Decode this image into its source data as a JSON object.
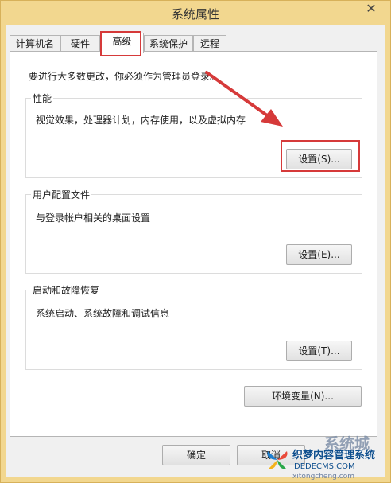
{
  "window": {
    "title": "系统属性",
    "close_glyph": "✕"
  },
  "tabs": [
    {
      "label": "计算机名"
    },
    {
      "label": "硬件"
    },
    {
      "label": "高级",
      "active": true
    },
    {
      "label": "系统保护"
    },
    {
      "label": "远程"
    }
  ],
  "note": "要进行大多数更改，你必须作为管理员登录。",
  "performance": {
    "title": "性能",
    "description": "视觉效果，处理器计划，内存使用，以及虚拟内存",
    "settings_label": "设置(S)..."
  },
  "user_profiles": {
    "title": "用户配置文件",
    "description": "与登录帐户相关的桌面设置",
    "settings_label": "设置(E)..."
  },
  "startup_recovery": {
    "title": "启动和故障恢复",
    "description": "系统启动、系统故障和调试信息",
    "settings_label": "设置(T)..."
  },
  "env_vars_label": "环境变量(N)...",
  "footer": {
    "ok_label": "确定",
    "cancel_label": "取消"
  },
  "watermark": {
    "main_text": "织梦内容管理系统",
    "url_text": "DEDECMS.COM",
    "brand_text": "系统城",
    "url2_text": "xitongcheng.com"
  },
  "colors": {
    "highlight_red": "#d63a3a",
    "title_bar": "#f2d78f",
    "watermark_blue": "#0f4f8e"
  },
  "icons": {
    "close": "close-icon",
    "annotation_arrow": "red-arrow-icon",
    "watermark_logo": "butterfly-logo-icon"
  }
}
